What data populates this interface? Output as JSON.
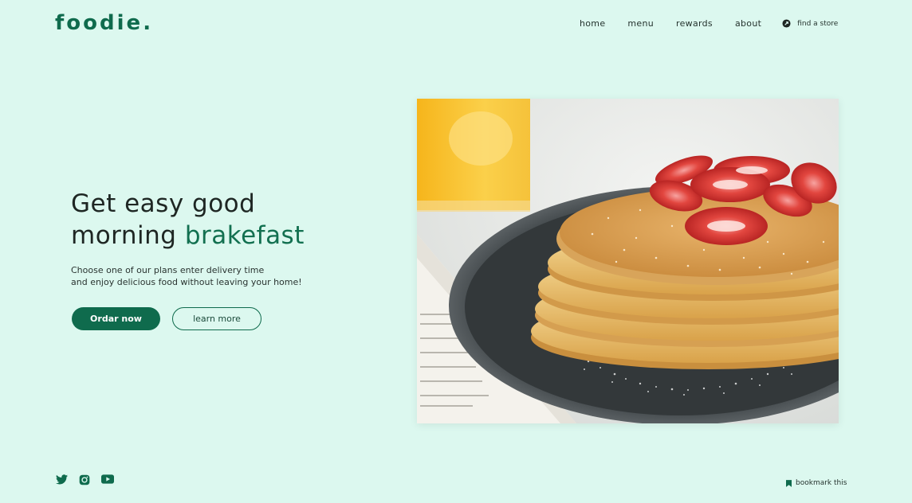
{
  "brand": {
    "logo_text": "foodie."
  },
  "nav": {
    "items": [
      {
        "label": "home"
      },
      {
        "label": "menu"
      },
      {
        "label": "rewards"
      },
      {
        "label": "about"
      }
    ],
    "find_store_label": "find a store",
    "find_store_icon": "location-pin-icon"
  },
  "hero": {
    "title_line1": "Get easy good",
    "title_line2_prefix": "morning ",
    "title_line2_accent": "brakefast",
    "subtitle_line1": "Choose one of our plans enter delivery time",
    "subtitle_line2": "and enjoy delicious food without leaving your home!",
    "primary_button": "Ordar now",
    "secondary_button": "learn more",
    "image_description_icon": "pancakes-photo"
  },
  "footer": {
    "social": [
      "twitter-icon",
      "instagram-icon",
      "youtube-icon"
    ],
    "bookmark_label": "bookmark this",
    "bookmark_icon": "bookmark-icon"
  },
  "colors": {
    "background": "#dcf8ef",
    "brand_green": "#0f6b4d",
    "text_dark": "#1e2623"
  }
}
